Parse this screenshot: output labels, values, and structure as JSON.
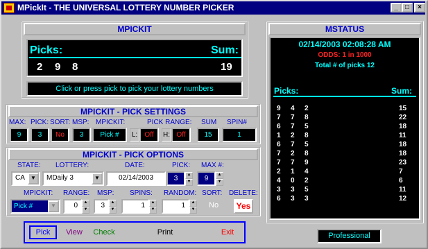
{
  "window": {
    "title": "MPickIt - THE UNIVERSAL LOTTERY NUMBER PICKER",
    "min_btn": "_",
    "max_btn": "□",
    "close_btn": "×"
  },
  "mpickit": {
    "header": "MPICKIT",
    "picks_label": "Picks:",
    "sum_label": "Sum:",
    "picks": [
      "2",
      "9",
      "8"
    ],
    "sum": "19",
    "hint": "Click or press pick to pick your lottery numbers"
  },
  "settings": {
    "header": "MPICKIT -  PICK SETTINGS",
    "labels": {
      "max": "MAX:",
      "pick": "PICK:",
      "sort": "SORT:",
      "msp": "MSP:",
      "mpickit": "MPICKIT:",
      "range": "PICK RANGE:",
      "sum": "SUM",
      "spin": "SPIN#"
    },
    "values": {
      "max": "9",
      "pick": "3",
      "sort": "No",
      "msp": "3",
      "mpickit": "Pick #",
      "l": "L:",
      "l_val": "Off",
      "h": "H:",
      "h_val": "Off",
      "sum": "15",
      "spin": "1"
    }
  },
  "options": {
    "header": "MPICKIT - PICK OPTIONS",
    "labels": {
      "state": "STATE:",
      "lottery": "LOTTERY:",
      "date": "DATE:",
      "pick": "PICK:",
      "max": "MAX #:",
      "mpickit": "MPICKIT:",
      "range": "RANGE:",
      "msp": "MSP:",
      "spins": "SPINS:",
      "random": "RANDOM:",
      "sort": "SORT:",
      "delete": "DELETE:"
    },
    "values": {
      "state": "CA",
      "lottery": "MDaily 3",
      "date": "02/14/2003",
      "pick": "3",
      "max": "9",
      "mpickit": "Pick #",
      "range": "0",
      "msp": "3",
      "spins": "1",
      "random": "1",
      "sort": "No",
      "delete": "Yes"
    }
  },
  "buttons": {
    "pick": "Pick",
    "view": "View",
    "check": "Check",
    "print": "Print",
    "exit": "Exit"
  },
  "mstatus": {
    "header": "MSTATUS",
    "datetime": "02/14/2003 02:08:28 AM",
    "odds": "ODDS: 1 in 1000",
    "total": "Total # of picks 12",
    "picks_label": "Picks:",
    "sum_label": "Sum:",
    "rows": [
      {
        "n": [
          "9",
          "4",
          "2"
        ],
        "sum": "15"
      },
      {
        "n": [
          "7",
          "7",
          "8"
        ],
        "sum": "22"
      },
      {
        "n": [
          "6",
          "7",
          "5"
        ],
        "sum": "18"
      },
      {
        "n": [
          "1",
          "2",
          "8"
        ],
        "sum": "11"
      },
      {
        "n": [
          "6",
          "7",
          "5"
        ],
        "sum": "18"
      },
      {
        "n": [
          "7",
          "2",
          "8"
        ],
        "sum": "18"
      },
      {
        "n": [
          "7",
          "7",
          "9"
        ],
        "sum": "23"
      },
      {
        "n": [
          "2",
          "1",
          "4"
        ],
        "sum": "7"
      },
      {
        "n": [
          "4",
          "0",
          "2"
        ],
        "sum": "6"
      },
      {
        "n": [
          "3",
          "3",
          "5"
        ],
        "sum": "11"
      },
      {
        "n": [
          "6",
          "3",
          "3"
        ],
        "sum": "12"
      }
    ],
    "edition": "Professional"
  },
  "colors": {
    "title_bar": "#000080",
    "cyan": "#00ffff",
    "red": "#ff2020",
    "blue": "#0000cc"
  },
  "icons": {
    "app": "lottery-app-icon",
    "minimize": "minimize-icon",
    "maximize": "maximize-icon",
    "close": "close-icon",
    "dropdown": "chevron-down-icon",
    "spin_up": "spin-up-icon",
    "spin_down": "spin-down-icon"
  }
}
